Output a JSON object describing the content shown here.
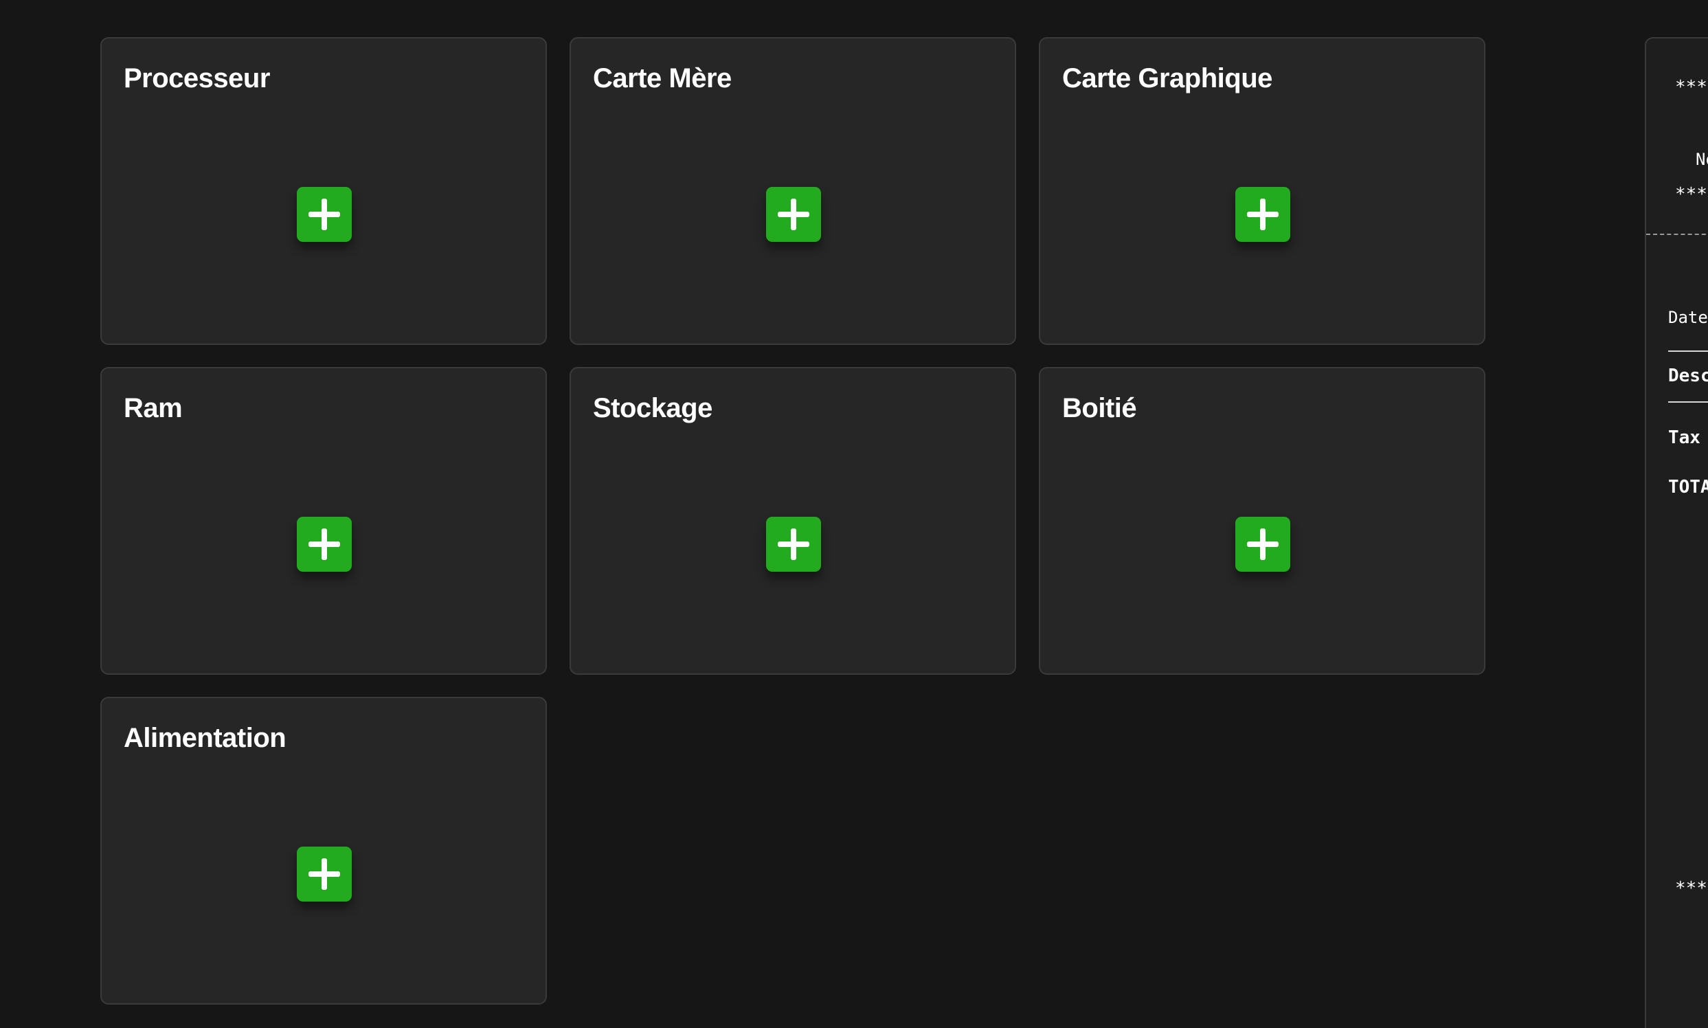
{
  "components": [
    {
      "title": "Processeur",
      "add_icon": "plus-icon"
    },
    {
      "title": "Carte Mère",
      "add_icon": "plus-icon"
    },
    {
      "title": "Carte Graphique",
      "add_icon": "plus-icon"
    },
    {
      "title": "Ram",
      "add_icon": "plus-icon"
    },
    {
      "title": "Stockage",
      "add_icon": "plus-icon"
    },
    {
      "title": "Boitié",
      "add_icon": "plus-icon"
    },
    {
      "title": "Alimentation",
      "add_icon": "plus-icon"
    }
  ],
  "receipt": {
    "top_stars": "*****",
    "name_fragment": "No",
    "stars_2": "*****",
    "date_label": "Date",
    "desc_header": "Desc",
    "tax_label": "Tax",
    "total_label": "TOTA",
    "bottom_stars": "*****"
  },
  "colors": {
    "background": "#161616",
    "card": "#262626",
    "card_border": "#3a3a3a",
    "add_button": "#22ab1e"
  }
}
